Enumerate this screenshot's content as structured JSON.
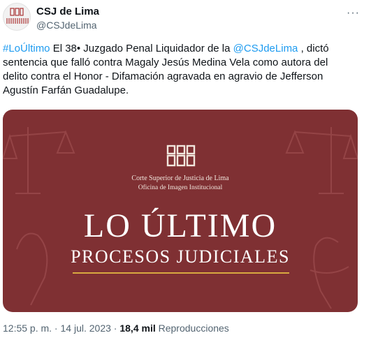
{
  "account": {
    "display_name": "CSJ de Lima",
    "handle": "@CSJdeLima",
    "more_label": "···"
  },
  "tweet": {
    "hashtag": "#LoÚltimo",
    "text_a": " El 38• Juzgado Penal Liquidador de la ",
    "mention": "@CSJdeLima",
    "text_b": " , dictó sentencia que falló contra Magaly Jesús Medina Vela como autora del delito contra el Honor - Difamación agravada en agravio de Jefferson Agustín Farfán Guadalupe."
  },
  "card": {
    "institution_line1": "Corte Superior de Justicia de Lima",
    "institution_line2": "Oficina de Imagen Institucional",
    "headline": "LO ÚLTIMO",
    "subheadline": "PROCESOS JUDICIALES",
    "background_color": "#7f3033",
    "accent_color": "#d8a940"
  },
  "meta": {
    "time": "12:55 p. m.",
    "separator": " · ",
    "date": "14 jul. 2023",
    "views": "18,4 mil",
    "views_label": " Reproducciones"
  }
}
